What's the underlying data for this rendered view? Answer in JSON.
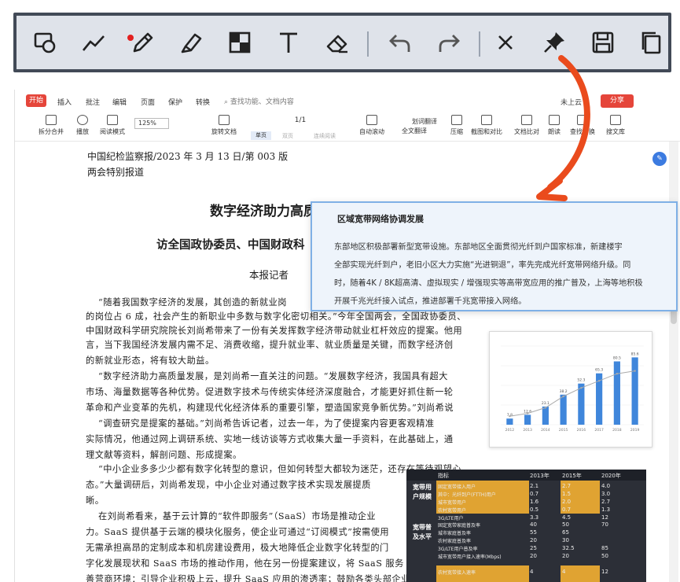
{
  "annotation_toolbar": {
    "tools": [
      {
        "name": "shape-tool",
        "icon": "shape-icon"
      },
      {
        "name": "line-tool",
        "icon": "trend-line-icon"
      },
      {
        "name": "pencil-tool",
        "icon": "pencil-icon"
      },
      {
        "name": "highlighter-tool",
        "icon": "highlighter-icon"
      },
      {
        "name": "mosaic-tool",
        "icon": "mosaic-icon"
      },
      {
        "name": "text-tool",
        "icon": "text-icon"
      },
      {
        "name": "eraser-tool",
        "icon": "eraser-icon"
      },
      {
        "name": "undo-tool",
        "icon": "undo-icon"
      },
      {
        "name": "redo-tool",
        "icon": "redo-icon"
      },
      {
        "name": "close-tool",
        "icon": "close-icon"
      },
      {
        "name": "pin-tool",
        "icon": "pin-icon"
      },
      {
        "name": "save-tool",
        "icon": "save-icon"
      },
      {
        "name": "copy-tool",
        "icon": "copy-icon"
      }
    ],
    "accent_color": "#e32020"
  },
  "wps": {
    "menu": {
      "start": "开始",
      "items": [
        "插入",
        "批注",
        "编辑",
        "页面",
        "保护",
        "转换"
      ],
      "search": "查找功能、文档内容",
      "cloud": "未上云",
      "share": "分享"
    },
    "tools": [
      "拆分合并",
      "播放",
      "阅读模式",
      "旋转文档",
      "单页",
      "双页",
      "连续阅读",
      "自动滚动",
      "全文翻译",
      "压缩",
      "截图和对比",
      "文档比对",
      "朗读",
      "查找替换",
      "搜文库"
    ],
    "zoom": "125%",
    "page": "1/1",
    "translate": "划词翻译"
  },
  "document": {
    "header_line1": "中国纪检监察报/2023 年 3 月 13 日/第 003 版",
    "header_line2": "两会特别报道",
    "title": "数字经济助力高质量发展",
    "subtitle": "访全国政协委员、中国财政科",
    "byline": "本报记者",
    "paragraphs": [
      "“随着我国数字经济的发展，其创造的新就业岗",
      "的岗位占 6 成，社会产生的新职业中多数与数字化密切相关。”今年全国两会，全国政协委员、",
      "中国财政科学研究院院长刘尚希带来了一份有关发挥数字经济带动就业杠杆效应的提案。他用",
      "言，当下我国经济发展内需不足、消费收缩，提升就业率、就业质量是关键，而数字经济创",
      "的新就业形态，将有较大助益。",
      "“数字经济助力高质量发展，是刘尚希一直关注的问题。“发展数字经济，我国具有超大",
      "市场、海量数据等各种优势。促进数字技术与传统实体经济深度融合，才能更好抓住新一轮",
      "革命和产业变革的先机，构建现代化经济体系的重要引擎，塑造国家竞争新优势。”刘尚希说",
      "“调查研究是提案的基础。”刘尚希告诉记者，过去一年，为了使提案内容更客观精准",
      "实际情况，他通过网上调研系统、实地一线访谈等方式收集大量一手资料，在此基础上，通",
      "理文献等资料，解剖问题、形成提案。",
      "“中小企业多多少少都有数字化转型的意识，但如何转型大都较为迷茫，还存在等待观望心",
      "态。”大量调研后，刘尚希发现，中小企业对通过数字技术实现发展提质",
      "晰。",
      "在刘尚希看来，基于云计算的“软件即服务”（SaaS）市场是推动企业",
      "力。SaaS 提供基于云端的模块化服务，使企业可通过“订阅模式”按需使用",
      "无需承担高昂的定制成本和机房建设费用，极大地降低企业数字化转型的门",
      "字化发展现状和 SaaS 市场的推动作用，他在另一份提案建议，将 SaaS 服务",
      "善营商环境：引导企业积极上云，提升 SaaS 应用的渗透率；鼓励各类头部企业发挥技术和人才"
    ]
  },
  "popup": {
    "title": "区域宽带网络协调发展",
    "lines": [
      "东部地区积极部署新型宽带设施。东部地区全面贯彻光纤到户国家标准，新建楼宇",
      "全部实现光纤到户，老旧小区大力实施“光进铜退”，率先完成光纤宽带网络升级。同",
      "时，随着4K / 8K超高清、虚拟现实 / 增强现实等高带宽应用的推广普及，上海等地积极",
      "开展千兆光纤接入试点，推进部署千兆宽带接入网络。"
    ]
  },
  "chart_data": {
    "type": "bar",
    "categories": [
      "2012",
      "2013",
      "2014",
      "2015",
      "2016",
      "2017",
      "2018",
      "2019"
    ],
    "series": [
      {
        "values": [
          7.8,
          12.6,
          23.1,
          38.2,
          52.3,
          65.3,
          80.5,
          85.6
        ]
      },
      {
        "values": [
          6,
          8,
          12,
          20,
          26,
          31,
          36,
          38
        ]
      }
    ],
    "bar_color": "#3f86db",
    "line_color": "#aaaaaa"
  },
  "table": {
    "header": [
      "指标",
      "2013年",
      "2015年",
      "2020年"
    ],
    "side1": "宽带用户规模",
    "side2": "宽带普及水平",
    "rows": [
      [
        "固定宽带接入用户",
        "2.1",
        "2.7",
        "4.0"
      ],
      [
        "其中：光纤到户(FTTH)用户",
        "0.7",
        "1.5",
        "3.0"
      ],
      [
        "城市宽带用户",
        "1.6",
        "2.0",
        "2.7"
      ],
      [
        "农村宽带用户",
        "0.5",
        "0.7",
        "1.3"
      ],
      [
        "3G/LTE用户",
        "3.3",
        "4.5",
        "12"
      ],
      [
        "固定宽带家庭普及率",
        "40",
        "50",
        "70"
      ],
      [
        "城市家庭普及率",
        "55",
        "65",
        ""
      ],
      [
        "农村家庭普及率",
        "20",
        "30",
        ""
      ],
      [
        "3G/LTE用户普及率",
        "25",
        "32.5",
        "85"
      ],
      [
        "城市宽带用户接入速率(Mbps)",
        "20",
        "20",
        "50"
      ],
      [
        "农村宽带接入速率",
        "4",
        "4",
        "12"
      ]
    ]
  }
}
